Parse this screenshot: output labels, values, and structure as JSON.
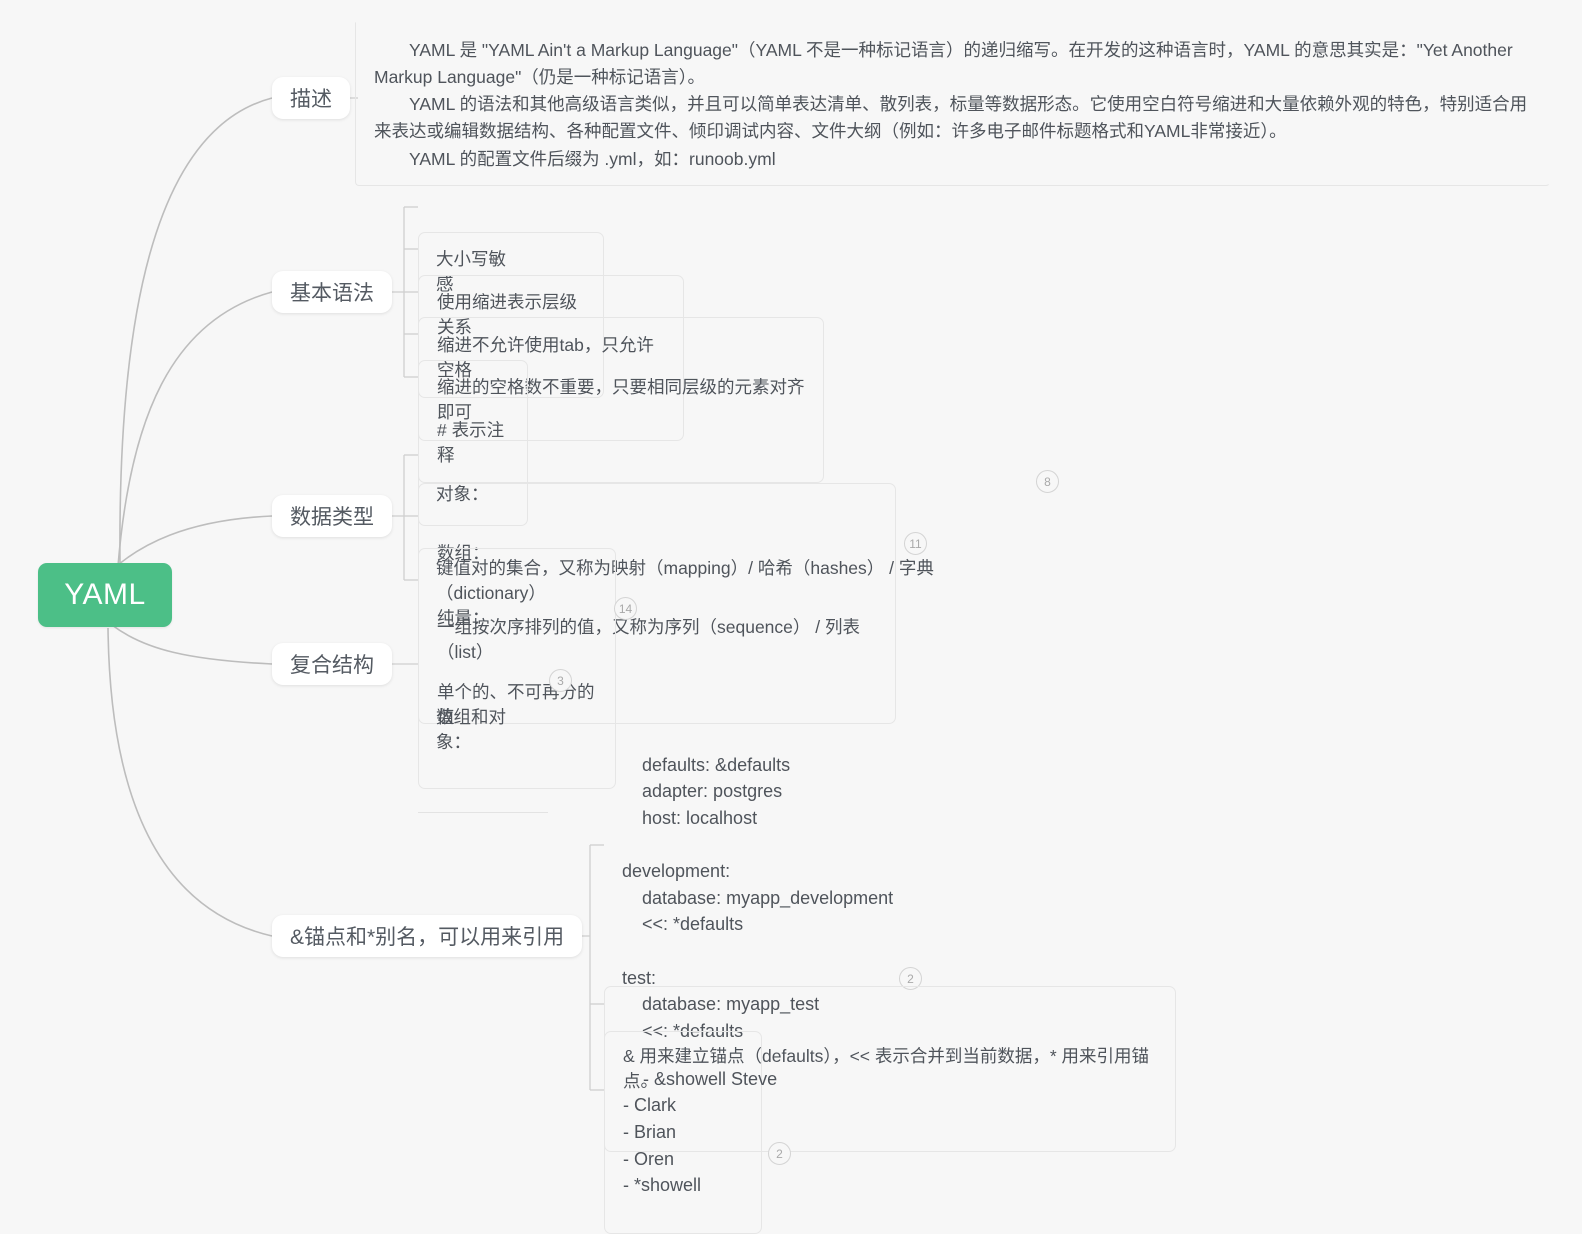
{
  "theme": {
    "background": "#f7f7f7",
    "root_color": "#4CBF87",
    "link_color": "#bdbdbd",
    "text_color": "#4f545b",
    "badge_color": "#a9a9a9"
  },
  "root": {
    "label": "YAML"
  },
  "topics": [
    {
      "id": "desc",
      "label": "描述"
    },
    {
      "id": "syntax",
      "label": "基本语法"
    },
    {
      "id": "types",
      "label": "数据类型"
    },
    {
      "id": "compose",
      "label": "复合结构"
    },
    {
      "id": "anchor",
      "label": "&锚点和*别名，可以用来引用"
    }
  ],
  "description": {
    "paragraphs": [
      "YAML 是 \"YAML Ain't a Markup Language\"（YAML 不是一种标记语言）的递归缩写。在开发的这种语言时，YAML 的意思其实是：\"Yet Another Markup Language\"（仍是一种标记语言）。",
      "YAML 的语法和其他高级语言类似，并且可以简单表达清单、散列表，标量等数据形态。它使用空白符号缩进和大量依赖外观的特色，特别适合用来表达或编辑数据结构、各种配置文件、倾印调试内容、文件大纲（例如：许多电子邮件标题格式和YAML非常接近）。",
      "YAML 的配置文件后缀为 .yml，如：runoob.yml"
    ]
  },
  "syntax": {
    "items": [
      {
        "text": "大小写敏感"
      },
      {
        "text": "使用缩进表示层级关系"
      },
      {
        "text": "缩进不允许使用tab，只允许空格"
      },
      {
        "text": "缩进的空格数不重要，只要相同层级的元素对齐即可"
      },
      {
        "text": "# 表示注释"
      }
    ]
  },
  "datatypes": {
    "items": [
      {
        "line1": "对象：",
        "line2": "键值对的集合，又称为映射（mapping）/ 哈希（hashes） / 字典（dictionary）",
        "badge": "8"
      },
      {
        "line1": "数组：",
        "line2": "一组按次序排列的值，又称为序列（sequence） / 列表（list）",
        "badge": "11"
      },
      {
        "line1": "纯量：",
        "line2": "单个的、不可再分的值",
        "badge": "14"
      }
    ]
  },
  "composite": {
    "items": [
      {
        "text": "数组和对象：",
        "badge": "3"
      }
    ]
  },
  "anchors": {
    "code_block": "defaults: &defaults\n    adapter: postgres\n    host: localhost\n\ndevelopment:\n    database: myapp_development\n    <<: *defaults\n\ntest:\n    database: myapp_test\n    <<: *defaults",
    "code_badge": "2",
    "note": "& 用来建立锚点（defaults），<< 表示合并到当前数据，* 用来引用锚点。",
    "list_block": "- &showell Steve\n- Clark\n- Brian\n- Oren\n- *showell",
    "list_badge": "2"
  }
}
